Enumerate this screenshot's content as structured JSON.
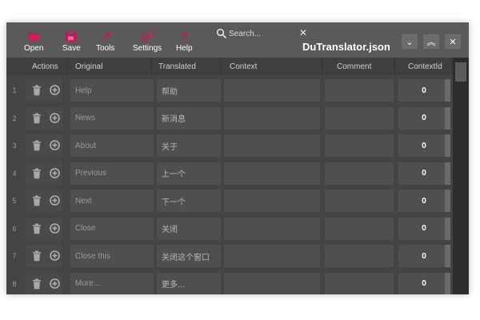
{
  "toolbar": {
    "open": "Open",
    "save": "Save",
    "tools": "Tools",
    "settings": "Settings",
    "help": "Help"
  },
  "search": {
    "placeholder": "Search..."
  },
  "window": {
    "title": "DuTranslator.json"
  },
  "icons": {
    "open": "folder-open-icon",
    "save": "save-icon",
    "tools": "wrench-icon",
    "settings": "gears-icon",
    "help": "question-icon",
    "search": "search-icon",
    "clear": "close-icon",
    "delete": "trash-icon",
    "add": "plus-circle-icon"
  },
  "colors": {
    "accent": "#c2185b",
    "background": "#444444",
    "toolbar": "#5a5a5a"
  },
  "columns": [
    "Actions",
    "Original",
    "Translated",
    "Context",
    "Comment",
    "ContextId"
  ],
  "rows": [
    {
      "n": "1",
      "original": "Help",
      "translated": "帮助",
      "context": "",
      "comment": "",
      "contextid": "0"
    },
    {
      "n": "2",
      "original": "News",
      "translated": "新消息",
      "context": "",
      "comment": "",
      "contextid": "0"
    },
    {
      "n": "3",
      "original": "About",
      "translated": "关于",
      "context": "",
      "comment": "",
      "contextid": "0"
    },
    {
      "n": "4",
      "original": "Previous",
      "translated": "上一个",
      "context": "",
      "comment": "",
      "contextid": "0"
    },
    {
      "n": "5",
      "original": "Next",
      "translated": "下一个",
      "context": "",
      "comment": "",
      "contextid": "0"
    },
    {
      "n": "6",
      "original": "Close",
      "translated": "关闭",
      "context": "",
      "comment": "",
      "contextid": "0"
    },
    {
      "n": "7",
      "original": "Close this",
      "translated": "关闭这个窗口",
      "context": "",
      "comment": "",
      "contextid": "0"
    },
    {
      "n": "8",
      "original": "More...",
      "translated": "更多...",
      "context": "",
      "comment": "",
      "contextid": "0"
    }
  ]
}
